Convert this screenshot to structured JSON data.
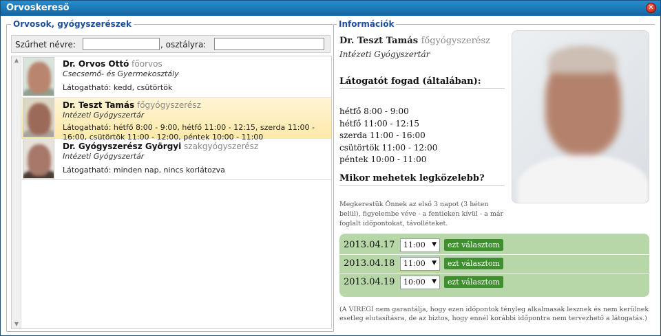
{
  "window": {
    "title": "Orvoskereső"
  },
  "left": {
    "legend": "Orvosok, gyógyszerészek",
    "filter": {
      "name_label": "Szűrhet névre:",
      "name_value": "",
      "dept_label": ", osztályra:",
      "dept_value": ""
    },
    "rows": [
      {
        "name": "Dr. Orvos Ottó",
        "title": "főorvos",
        "dept": "Csecsemő- és Gyermekosztály",
        "visit": "Látogatható: kedd, csütörtök"
      },
      {
        "name": "Dr. Teszt Tamás",
        "title": "főgyógyszerész",
        "dept": "Intézeti Gyógyszertár",
        "visit": "Látogatható: hétfő 8:00 - 9:00, hétfő 11:00 - 12:15, szerda 11:00 - 16:00, csütörtök 11:00 - 12:00, péntek 10:00 - 11:00"
      },
      {
        "name": "Dr. Gyógyszerész Györgyi",
        "title": "szakgyógyszerész",
        "dept": "Intézeti Gyógyszertár",
        "visit": "Látogatható: minden nap, nincs korlátozva"
      }
    ]
  },
  "info": {
    "legend": "Információk",
    "name": "Dr. Teszt Tamás",
    "title": "főgyógyszerész",
    "dept": "Intézeti Gyógyszertár",
    "hours_heading": "Látogatót fogad (általában):",
    "hours": [
      "hétfő 8:00 - 9:00",
      "hétfő 11:00 - 12:15",
      "szerda 11:00 - 16:00",
      "csütörtök 11:00 - 12:00",
      "péntek 10:00 - 11:00"
    ],
    "when_heading": "Mikor mehetek legközelebb?",
    "when_note": "Megkerestük Önnek az első 3 napot (3 héten belül), figyelembe véve - a fentieken kívül - a már foglalt időpontokat, távolléteket.",
    "slots": [
      {
        "date": "2013.04.17",
        "time": "11:00",
        "button": "ezt választom"
      },
      {
        "date": "2013.04.18",
        "time": "11:00",
        "button": "ezt választom"
      },
      {
        "date": "2013.04.19",
        "time": "10:00",
        "button": "ezt választom"
      }
    ],
    "disclaimer": "(A VIREGI nem garantálja, hogy ezen időpontok tényleg alkalmasak lesznek és nem kerülnek esetleg elutasításra, de az biztos, hogy ennél korábbi időpontra nem tervezhető a látogatás.)"
  },
  "colors": {
    "titlebar": "#1a73b5",
    "legend": "#1f4e99",
    "selected_row": "#fde9a8",
    "slots_bg": "#b7d7a8",
    "slot_button": "#3f8f2e"
  },
  "icons": {
    "close": "close-icon",
    "dropdown": "chevron-down-icon"
  }
}
